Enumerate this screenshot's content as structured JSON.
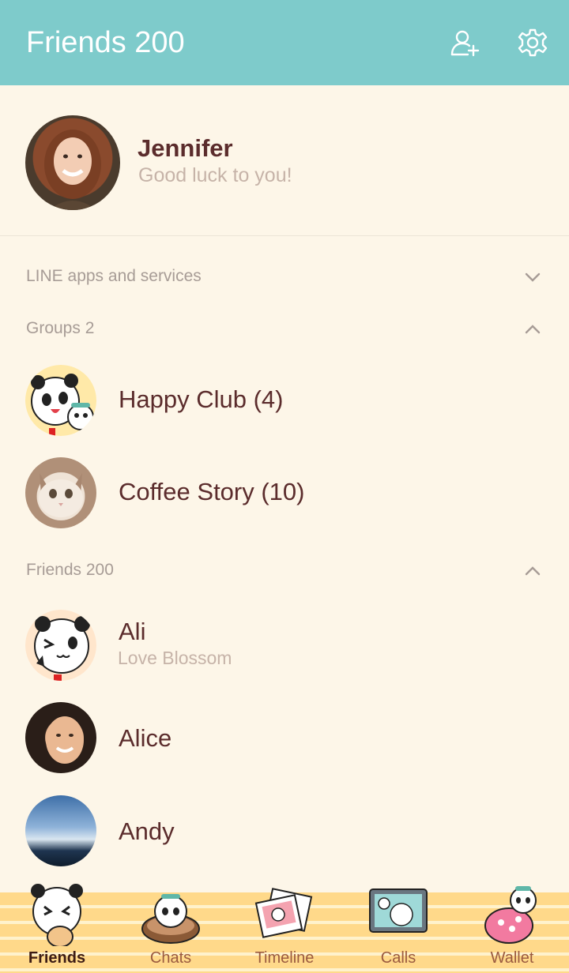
{
  "header": {
    "title": "Friends 200"
  },
  "profile": {
    "name": "Jennifer",
    "status": "Good luck to you!"
  },
  "sections": {
    "line_apps": {
      "label": "LINE apps and services",
      "state": "collapsed"
    },
    "groups": {
      "label": "Groups 2",
      "state": "expanded"
    },
    "friends": {
      "label": "Friends 200",
      "state": "expanded"
    }
  },
  "groups": [
    {
      "name": "Happy Club (4)"
    },
    {
      "name": "Coffee Story (10)"
    }
  ],
  "friends": [
    {
      "name": "Ali",
      "status": "Love Blossom"
    },
    {
      "name": "Alice"
    },
    {
      "name": "Andy"
    }
  ],
  "nav": {
    "items": [
      {
        "label": "Friends",
        "active": true
      },
      {
        "label": "Chats",
        "active": false
      },
      {
        "label": "Timeline",
        "active": false
      },
      {
        "label": "Calls",
        "active": false
      },
      {
        "label": "Wallet",
        "active": false
      }
    ]
  },
  "colors": {
    "header_bg": "#7ecbcb",
    "page_bg": "#fdf6e8",
    "name_text": "#5b2c2c",
    "muted_text": "#c6b3a8",
    "nav_bg": "#ffd98a"
  },
  "icons": {
    "add_friend": "add-friend-icon",
    "settings": "gear-icon",
    "chevron_down": "chevron-down-icon",
    "chevron_up": "chevron-up-icon"
  }
}
